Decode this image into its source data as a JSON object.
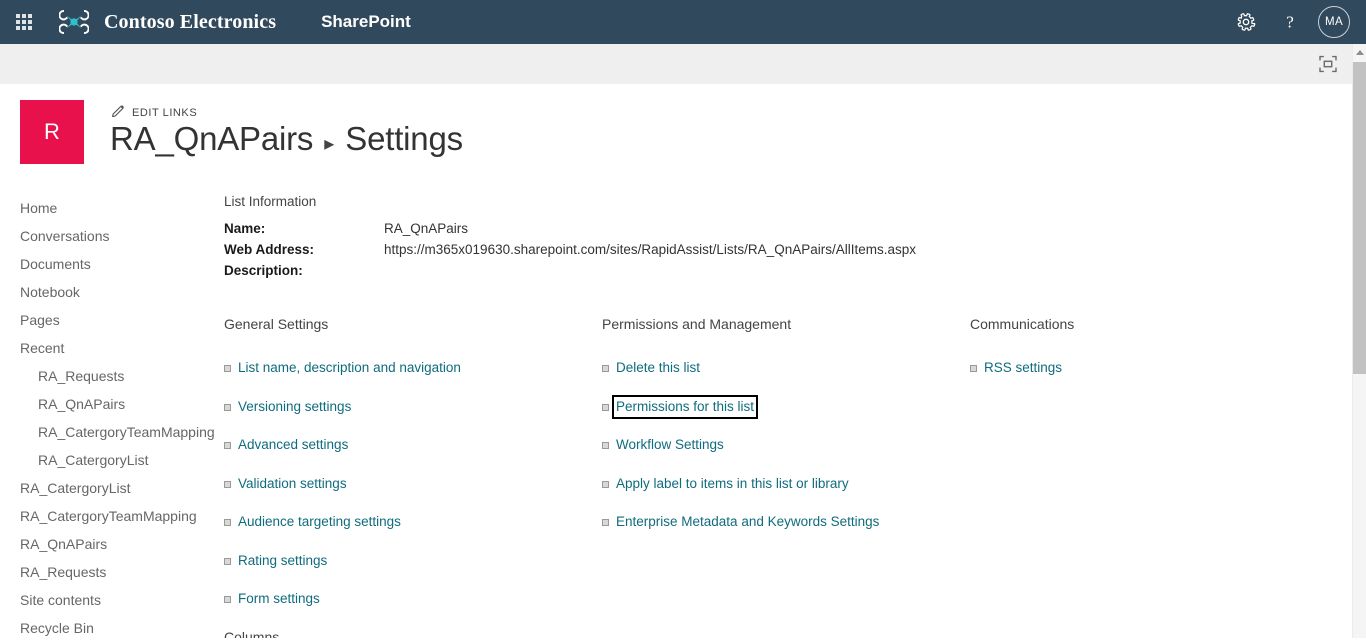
{
  "suite_bar": {
    "waffle_label": "app-launcher",
    "brand_name": "Contoso Electronics",
    "app_name": "SharePoint",
    "settings_icon": "gear-icon",
    "help_icon": "question-mark-icon",
    "avatar_initials": "MA"
  },
  "command_strip": {
    "focus_icon": "focus-on-content-icon"
  },
  "site_header": {
    "logo_letter": "R",
    "edit_links_label": "EDIT LINKS",
    "edit_links_icon": "pencil-icon",
    "title": "RA_QnAPairs",
    "separator": "▸",
    "subtitle": "Settings"
  },
  "left_nav": {
    "items": [
      {
        "label": "Home",
        "child": false
      },
      {
        "label": "Conversations",
        "child": false
      },
      {
        "label": "Documents",
        "child": false
      },
      {
        "label": "Notebook",
        "child": false
      },
      {
        "label": "Pages",
        "child": false
      },
      {
        "label": "Recent",
        "child": false
      },
      {
        "label": "RA_Requests",
        "child": true
      },
      {
        "label": "RA_QnAPairs",
        "child": true
      },
      {
        "label": "RA_CatergoryTeamMapping",
        "child": true
      },
      {
        "label": "RA_CatergoryList",
        "child": true
      },
      {
        "label": "RA_CatergoryList",
        "child": false
      },
      {
        "label": "RA_CatergoryTeamMapping",
        "child": false
      },
      {
        "label": "RA_QnAPairs",
        "child": false
      },
      {
        "label": "RA_Requests",
        "child": false
      },
      {
        "label": "Site contents",
        "child": false
      },
      {
        "label": "Recycle Bin",
        "child": false
      }
    ]
  },
  "list_information": {
    "heading": "List Information",
    "rows": [
      {
        "label": "Name:",
        "value": "RA_QnAPairs"
      },
      {
        "label": "Web Address:",
        "value": "https://m365x019630.sharepoint.com/sites/RapidAssist/Lists/RA_QnAPairs/AllItems.aspx"
      },
      {
        "label": "Description:",
        "value": ""
      }
    ]
  },
  "columns": {
    "general": {
      "heading": "General Settings",
      "links": [
        {
          "label": "List name, description and navigation",
          "focused": false
        },
        {
          "label": "Versioning settings",
          "focused": false
        },
        {
          "label": "Advanced settings",
          "focused": false
        },
        {
          "label": "Validation settings",
          "focused": false
        },
        {
          "label": "Audience targeting settings",
          "focused": false
        },
        {
          "label": "Rating settings",
          "focused": false
        },
        {
          "label": "Form settings",
          "focused": false
        }
      ]
    },
    "permissions": {
      "heading": "Permissions and Management",
      "links": [
        {
          "label": "Delete this list",
          "focused": false
        },
        {
          "label": "Permissions for this list",
          "focused": true
        },
        {
          "label": "Workflow Settings",
          "focused": false
        },
        {
          "label": "Apply label to items in this list or library",
          "focused": false
        },
        {
          "label": "Enterprise Metadata and Keywords Settings",
          "focused": false
        }
      ]
    },
    "communications": {
      "heading": "Communications",
      "links": [
        {
          "label": "RSS settings",
          "focused": false
        }
      ]
    }
  },
  "below_fold": {
    "partial_heading": "Columns"
  },
  "colors": {
    "suite_bar": "#31495C",
    "site_logo": "#E8114B",
    "link": "#0F6C7E",
    "command_strip": "#EFEFEF",
    "scrollbar_thumb": "#C2C2C2"
  }
}
